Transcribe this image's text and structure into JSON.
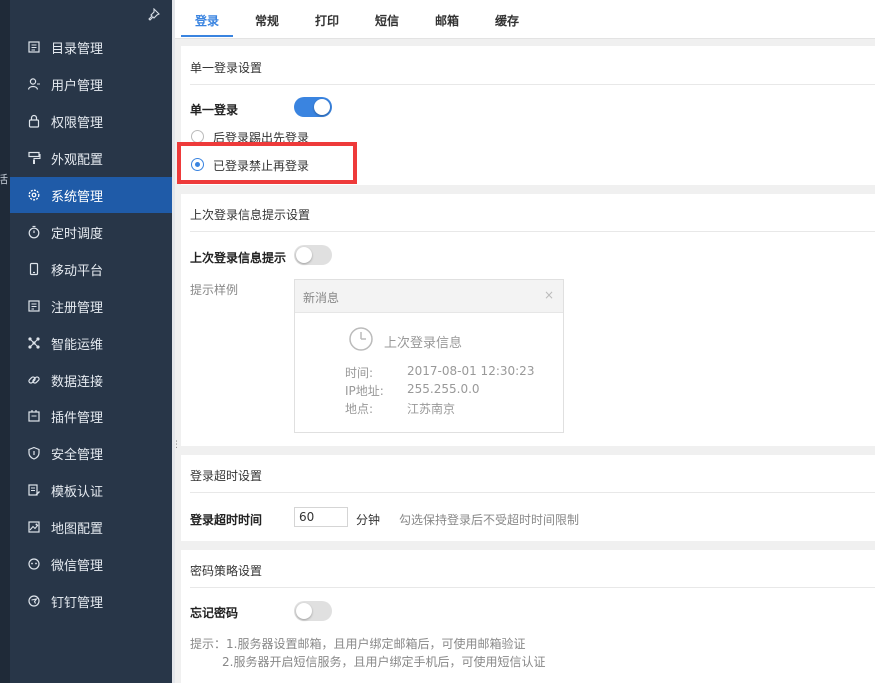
{
  "edge": {
    "glyph": "活"
  },
  "sidebar": {
    "items": [
      {
        "label": "目录管理",
        "icon": "catalog-icon"
      },
      {
        "label": "用户管理",
        "icon": "user-icon"
      },
      {
        "label": "权限管理",
        "icon": "lock-icon"
      },
      {
        "label": "外观配置",
        "icon": "brush-icon"
      },
      {
        "label": "系统管理",
        "icon": "gear-icon",
        "active": true
      },
      {
        "label": "定时调度",
        "icon": "timer-icon"
      },
      {
        "label": "移动平台",
        "icon": "mobile-icon"
      },
      {
        "label": "注册管理",
        "icon": "register-icon"
      },
      {
        "label": "智能运维",
        "icon": "ops-icon"
      },
      {
        "label": "数据连接",
        "icon": "link-icon"
      },
      {
        "label": "插件管理",
        "icon": "plugin-icon"
      },
      {
        "label": "安全管理",
        "icon": "shield-icon"
      },
      {
        "label": "模板认证",
        "icon": "template-icon"
      },
      {
        "label": "地图配置",
        "icon": "map-icon"
      },
      {
        "label": "微信管理",
        "icon": "wechat-icon"
      },
      {
        "label": "钉钉管理",
        "icon": "dingtalk-icon"
      }
    ]
  },
  "tabs": [
    "登录",
    "常规",
    "打印",
    "短信",
    "邮箱",
    "缓存"
  ],
  "single_login": {
    "section_title": "单一登录设置",
    "label": "单一登录",
    "enabled": true,
    "option_kick": "后登录踢出先登录",
    "option_block": "已登录禁止再登录",
    "selected": "option_block"
  },
  "last_login": {
    "section_title": "上次登录信息提示设置",
    "label": "上次登录信息提示",
    "enabled": false,
    "sample_label": "提示样例",
    "notice": {
      "title": "新消息",
      "close": "×",
      "subtitle": "上次登录信息",
      "time_key": "时间:",
      "time_val": "2017-08-01 12:30:23",
      "ip_key": "IP地址:",
      "ip_val": "255.255.0.0",
      "place_key": "地点:",
      "place_val": "江苏南京"
    }
  },
  "timeout": {
    "section_title": "登录超时设置",
    "label": "登录超时时间",
    "value": "60",
    "unit": "分钟",
    "hint": "勾选保持登录后不受超时时间限制"
  },
  "password": {
    "section_title": "密码策略设置",
    "label": "忘记密码",
    "enabled": false,
    "tip1": "提示：1.服务器设置邮箱，且用户绑定邮箱后，可使用邮箱验证",
    "tip2": "2.服务器开启短信服务，且用户绑定手机后，可使用短信认证"
  },
  "colors": {
    "accent": "#3a84e0",
    "sidebar": "#283648",
    "active_nav": "#1f5ba8",
    "highlight": "#ee3a3a"
  }
}
